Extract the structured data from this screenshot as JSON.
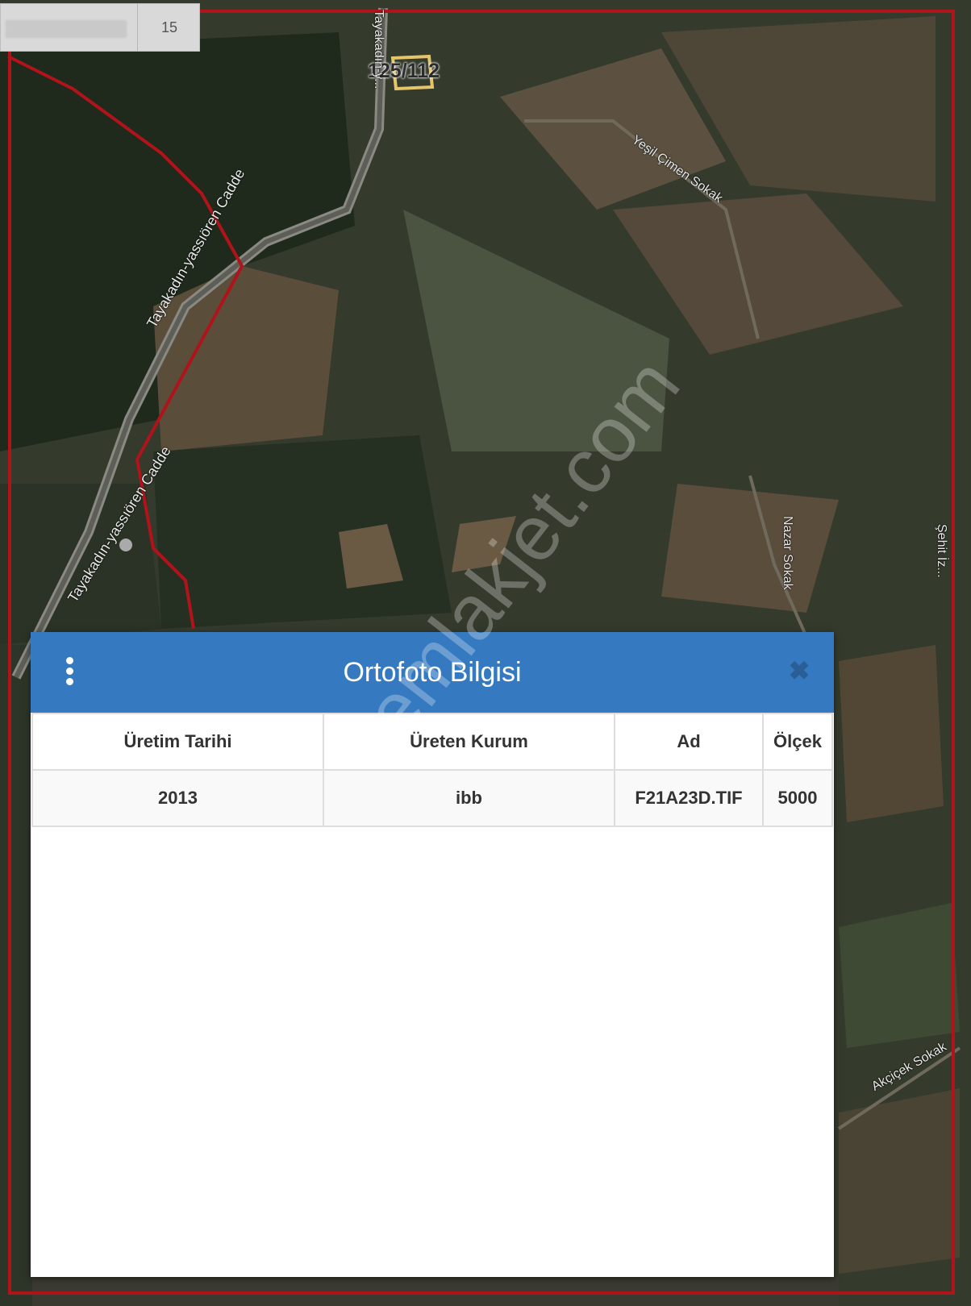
{
  "top_widget": {
    "value": "15"
  },
  "map": {
    "parcel_label": "125/112",
    "road_labels": [
      "Tayakadın-yassıören Cadde",
      "Tayakadın-yassıören Cadde",
      "Yeşil Çimen Sokak",
      "Nazar Sokak",
      "Akçiçek Sokak",
      "Tayakadın-y...",
      "Şehit İz..."
    ],
    "watermark": "emlakjet.com",
    "colors": {
      "boundary": "#b0141a",
      "parcel_outline": "#e6c46a"
    }
  },
  "panel": {
    "title": "Ortofoto Bilgisi",
    "menu_icon": "vertical-dots-icon",
    "close_icon": "close-x-icon",
    "header_color": "#3579c1",
    "table": {
      "headers": [
        "Üretim Tarihi",
        "Üreten Kurum",
        "Ad",
        "Ölçek"
      ],
      "rows": [
        [
          "2013",
          "ibb",
          "F21A23D.TIF",
          "5000"
        ]
      ]
    }
  }
}
